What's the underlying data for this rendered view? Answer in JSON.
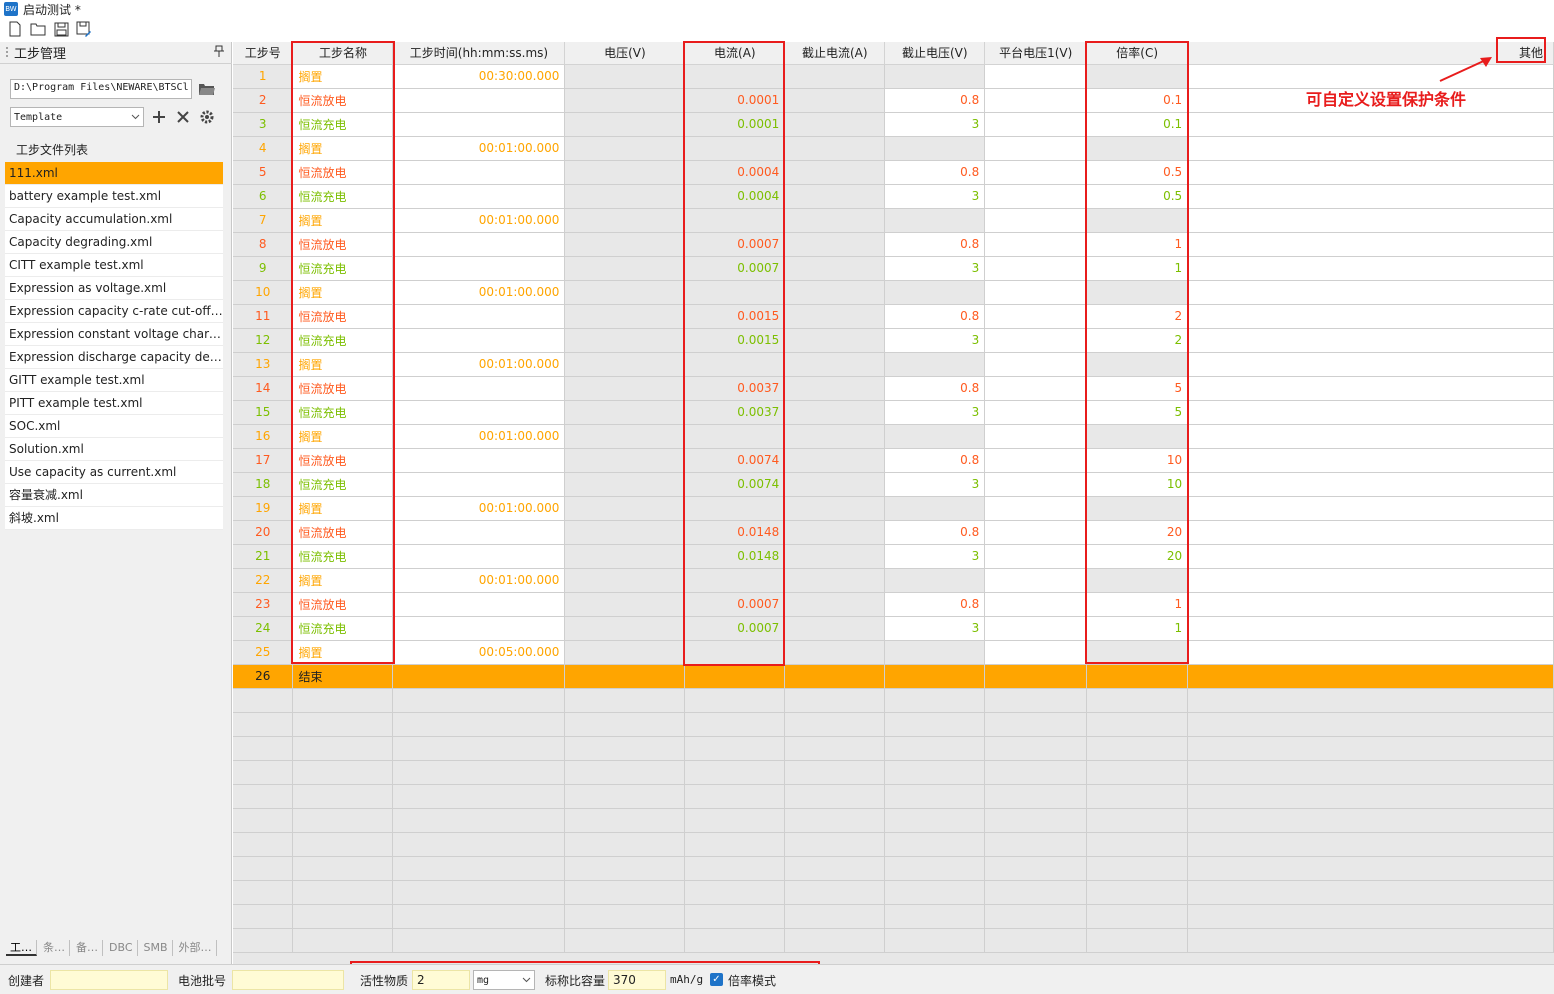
{
  "window": {
    "title": "启动测试 *"
  },
  "panel": {
    "title": "工步管理",
    "path": "D:\\Program Files\\NEWARE\\BTSCl",
    "template": "Template",
    "list_title": "工步文件列表"
  },
  "files": [
    "111.xml",
    "battery example test.xml",
    "Capacity accumulation.xml",
    "Capacity degrading.xml",
    "CITT example test.xml",
    "Expression as voltage.xml",
    "Expression capacity c-rate cut-off....",
    "Expression constant voltage charg...",
    "Expression discharge capacity del...",
    "GITT example test.xml",
    "PITT example test.xml",
    "SOC.xml",
    "Solution.xml",
    "Use capacity as current.xml",
    "容量衰减.xml",
    "斜坡.xml"
  ],
  "sidebar_tabs": [
    "工…",
    "条…",
    "备…",
    "DBC",
    "SMB",
    "外部…"
  ],
  "columns": [
    "工步号",
    "工步名称",
    "工步时间(hh:mm:ss.ms)",
    "电压(V)",
    "电流(A)",
    "截止电流(A)",
    "截止电压(V)",
    "平台电压1(V)",
    "倍率(C)",
    "其他"
  ],
  "steps": [
    {
      "no": "1",
      "name": "搁置",
      "type": "rest",
      "time": "00:30:00.000",
      "current": "",
      "cut_v": "",
      "rate": ""
    },
    {
      "no": "2",
      "name": "恒流放电",
      "type": "dis",
      "time": "",
      "current": "0.0001",
      "cut_v": "0.8",
      "rate": "0.1"
    },
    {
      "no": "3",
      "name": "恒流充电",
      "type": "chg",
      "time": "",
      "current": "0.0001",
      "cut_v": "3",
      "rate": "0.1"
    },
    {
      "no": "4",
      "name": "搁置",
      "type": "rest",
      "time": "00:01:00.000",
      "current": "",
      "cut_v": "",
      "rate": ""
    },
    {
      "no": "5",
      "name": "恒流放电",
      "type": "dis",
      "time": "",
      "current": "0.0004",
      "cut_v": "0.8",
      "rate": "0.5"
    },
    {
      "no": "6",
      "name": "恒流充电",
      "type": "chg",
      "time": "",
      "current": "0.0004",
      "cut_v": "3",
      "rate": "0.5"
    },
    {
      "no": "7",
      "name": "搁置",
      "type": "rest",
      "time": "00:01:00.000",
      "current": "",
      "cut_v": "",
      "rate": ""
    },
    {
      "no": "8",
      "name": "恒流放电",
      "type": "dis",
      "time": "",
      "current": "0.0007",
      "cut_v": "0.8",
      "rate": "1"
    },
    {
      "no": "9",
      "name": "恒流充电",
      "type": "chg",
      "time": "",
      "current": "0.0007",
      "cut_v": "3",
      "rate": "1"
    },
    {
      "no": "10",
      "name": "搁置",
      "type": "rest",
      "time": "00:01:00.000",
      "current": "",
      "cut_v": "",
      "rate": ""
    },
    {
      "no": "11",
      "name": "恒流放电",
      "type": "dis",
      "time": "",
      "current": "0.0015",
      "cut_v": "0.8",
      "rate": "2"
    },
    {
      "no": "12",
      "name": "恒流充电",
      "type": "chg",
      "time": "",
      "current": "0.0015",
      "cut_v": "3",
      "rate": "2"
    },
    {
      "no": "13",
      "name": "搁置",
      "type": "rest",
      "time": "00:01:00.000",
      "current": "",
      "cut_v": "",
      "rate": ""
    },
    {
      "no": "14",
      "name": "恒流放电",
      "type": "dis",
      "time": "",
      "current": "0.0037",
      "cut_v": "0.8",
      "rate": "5"
    },
    {
      "no": "15",
      "name": "恒流充电",
      "type": "chg",
      "time": "",
      "current": "0.0037",
      "cut_v": "3",
      "rate": "5"
    },
    {
      "no": "16",
      "name": "搁置",
      "type": "rest",
      "time": "00:01:00.000",
      "current": "",
      "cut_v": "",
      "rate": ""
    },
    {
      "no": "17",
      "name": "恒流放电",
      "type": "dis",
      "time": "",
      "current": "0.0074",
      "cut_v": "0.8",
      "rate": "10"
    },
    {
      "no": "18",
      "name": "恒流充电",
      "type": "chg",
      "time": "",
      "current": "0.0074",
      "cut_v": "3",
      "rate": "10"
    },
    {
      "no": "19",
      "name": "搁置",
      "type": "rest",
      "time": "00:01:00.000",
      "current": "",
      "cut_v": "",
      "rate": ""
    },
    {
      "no": "20",
      "name": "恒流放电",
      "type": "dis",
      "time": "",
      "current": "0.0148",
      "cut_v": "0.8",
      "rate": "20"
    },
    {
      "no": "21",
      "name": "恒流充电",
      "type": "chg",
      "time": "",
      "current": "0.0148",
      "cut_v": "3",
      "rate": "20"
    },
    {
      "no": "22",
      "name": "搁置",
      "type": "rest",
      "time": "00:01:00.000",
      "current": "",
      "cut_v": "",
      "rate": ""
    },
    {
      "no": "23",
      "name": "恒流放电",
      "type": "dis",
      "time": "",
      "current": "0.0007",
      "cut_v": "0.8",
      "rate": "1"
    },
    {
      "no": "24",
      "name": "恒流充电",
      "type": "chg",
      "time": "",
      "current": "0.0007",
      "cut_v": "3",
      "rate": "1"
    },
    {
      "no": "25",
      "name": "搁置",
      "type": "rest",
      "time": "00:05:00.000",
      "current": "",
      "cut_v": "",
      "rate": ""
    },
    {
      "no": "26",
      "name": "结束",
      "type": "end",
      "time": "",
      "current": "",
      "cut_v": "",
      "rate": ""
    }
  ],
  "annotation": {
    "text": "可自定义设置保护条件"
  },
  "bottom": {
    "creator_label": "创建者",
    "creator": "",
    "batch_label": "电池批号",
    "batch": "",
    "active_label": "活性物质",
    "active_value": "2",
    "active_unit": "mg",
    "capacity_label": "标称比容量",
    "capacity_value": "370",
    "capacity_unit": "mAh/g",
    "rate_mode_label": "倍率模式",
    "rate_mode_checked": true
  },
  "colors": {
    "rest": "#ffa500",
    "discharge": "#ff5a1f",
    "charge": "#7cbf00",
    "selected": "#ffa500",
    "annotation": "#e81c1c"
  }
}
